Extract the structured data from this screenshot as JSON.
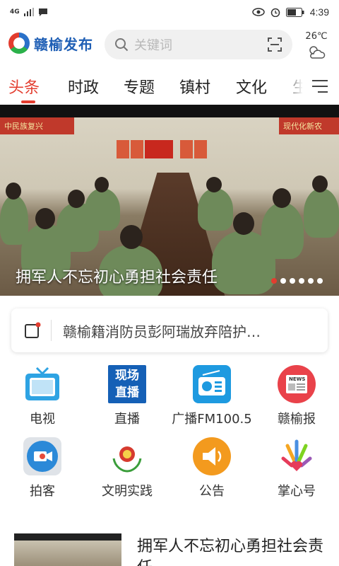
{
  "status": {
    "network": "4G",
    "time": "4:39"
  },
  "header": {
    "app_name": "赣榆发布",
    "search_placeholder": "关键词",
    "temperature": "26℃"
  },
  "tabs": [
    {
      "label": "头条"
    },
    {
      "label": "时政"
    },
    {
      "label": "专题"
    },
    {
      "label": "镇村"
    },
    {
      "label": "文化"
    },
    {
      "label": "生"
    }
  ],
  "banner": {
    "title": "拥军人不忘初心勇担社会责任",
    "slide_index": 1,
    "slide_count": 6,
    "wall_banner_left": "中民族复兴",
    "wall_banner_right": "现代化新农"
  },
  "notice": {
    "text": "赣榆籍消防员彭阿瑞放弃陪护…"
  },
  "grid": [
    {
      "label": "电视",
      "icon": "tv-icon"
    },
    {
      "label": "直播",
      "icon": "live-icon",
      "icon_text": [
        "现场",
        "直播"
      ]
    },
    {
      "label": "广播FM100.5",
      "icon": "radio-icon"
    },
    {
      "label": "赣榆报",
      "icon": "newspaper-icon",
      "icon_text": "NEWS"
    },
    {
      "label": "拍客",
      "icon": "video-camera-icon"
    },
    {
      "label": "文明实践",
      "icon": "civilization-emblem-icon"
    },
    {
      "label": "公告",
      "icon": "speaker-icon"
    },
    {
      "label": "掌心号",
      "icon": "colorful-hands-icon"
    }
  ],
  "news": [
    {
      "title": "拥军人不忘初心勇担社会责任"
    }
  ],
  "colors": {
    "accent": "#e33d2f",
    "brand_blue": "#1f5fb5"
  }
}
